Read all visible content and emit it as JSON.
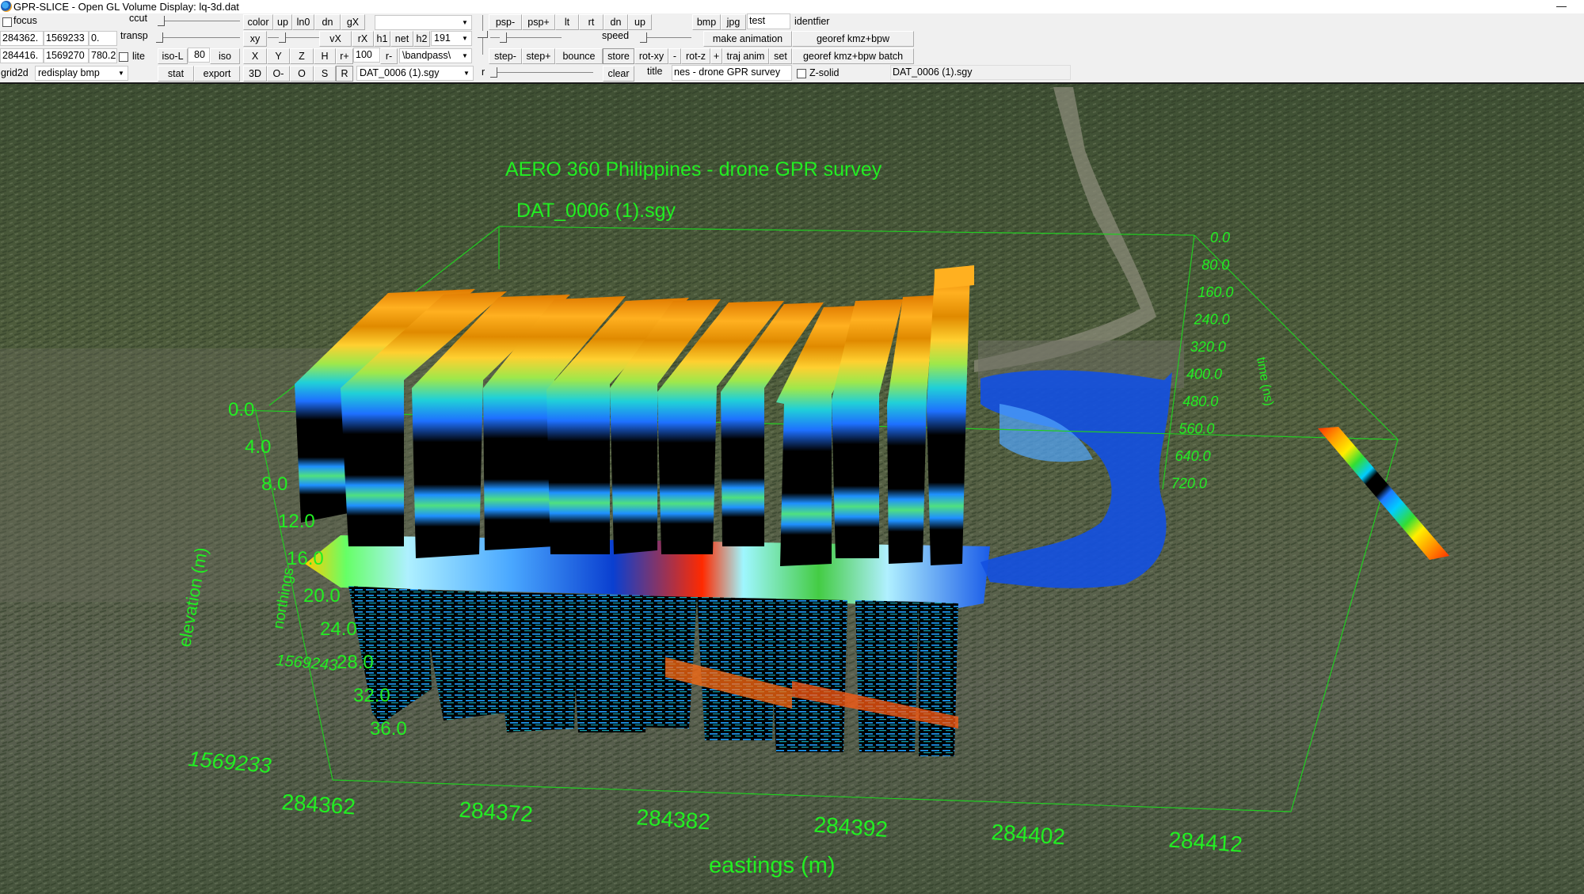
{
  "window": {
    "title": "GPR-SLICE -  Open GL Volume Display:     lq-3d.dat",
    "minimize_icon": "minimize-icon"
  },
  "toolbar": {
    "focus_label": "focus",
    "focus_checked": false,
    "ccut_label": "ccut",
    "transp_label": "transp",
    "coord_min_x": "284362.",
    "coord_min_y": "1569233",
    "coord_min_z": "0.",
    "coord_max_x": "284416.",
    "coord_max_y": "1569270",
    "coord_max_z": "780.2",
    "lite_label": "lite",
    "lite_checked": false,
    "iso_l_label": "iso-L",
    "iso_value": "80",
    "iso_label": "iso",
    "grid2d_label": "grid2d",
    "redisplay_select": "redisplay bmp",
    "stat_label": "stat",
    "export_label": "export",
    "color_label": "color",
    "up_label": "up",
    "ln0_label": "ln0",
    "dn_label": "dn",
    "gx_label": "gX",
    "top_combo_value": "",
    "xy_label": "xy",
    "vx_label": "vX",
    "rx_label": "rX",
    "h1_label": "h1",
    "net_label": "net",
    "h2_label": "h2",
    "h2_value": "191",
    "x_label": "X",
    "y_label": "Y",
    "z_label": "Z",
    "h_label": "H",
    "rplus_label": "r+",
    "r_value": "100",
    "rminus_label": "r-",
    "filter_select": "\\bandpass\\",
    "btn_3d": "3D",
    "btn_ominus": "O-",
    "btn_o": "O",
    "btn_s": "S",
    "btn_r": "R",
    "file_select": "DAT_0006 (1).sgy",
    "r_slider_label": "r",
    "psp_minus": "psp-",
    "psp_plus": "psp+",
    "lt_label": "lt",
    "rt_label": "rt",
    "dn2_label": "dn",
    "up2_label": "up",
    "speed_label": "speed",
    "step_minus": "step-",
    "step_plus": "step+",
    "bounce_label": "bounce",
    "store_label": "store",
    "rot_xy_label": "rot-xy",
    "minus_label": "-",
    "rot_z_label": "rot-z",
    "plus_label": "+",
    "traj_anim_label": "traj anim",
    "set_label": "set",
    "clear_label": "clear",
    "title_label": "title",
    "title_value": "nes - drone GPR survey",
    "bmp_label": "bmp",
    "jpg_label": "jpg",
    "identifier_value": "test",
    "identifier_label": "identfier",
    "make_animation_label": "make animation",
    "georef_label": "georef kmz+bpw",
    "georef_batch_label": "georef kmz+bpw batch",
    "zsolid_label": "Z-solid",
    "zsolid_checked": false,
    "current_file_display": "DAT_0006 (1).sgy"
  },
  "scene": {
    "title": "AERO 360 Philippines - drone GPR survey",
    "subtitle": "DAT_0006 (1).sgy",
    "axis_color": "#22ee22",
    "elevation_axis": {
      "label": "elevation (m)",
      "ticks": [
        "0.0",
        "4.0",
        "8.0",
        "12.0",
        "16.0",
        "20.0",
        "24.0",
        "28.0",
        "32.0",
        "36.0"
      ]
    },
    "time_axis": {
      "label": "time (ns)",
      "ticks": [
        "0.0",
        "80.0",
        "160.0",
        "240.0",
        "320.0",
        "400.0",
        "480.0",
        "560.0",
        "640.0",
        "720.0"
      ]
    },
    "northings_axis": {
      "label": "northings",
      "ticks": [
        "1569233",
        "1569243"
      ]
    },
    "eastings_axis": {
      "label": "eastings (m)",
      "ticks": [
        "284362",
        "284372",
        "284382",
        "284392",
        "284402",
        "284412"
      ]
    },
    "colorbar": [
      "#ff2a00",
      "#ff9900",
      "#ffee00",
      "#33dd33",
      "#00ccff",
      "#000000",
      "#1e78ff",
      "#00ccff",
      "#33dd33",
      "#ffee00",
      "#ff9900",
      "#ff2a00"
    ]
  }
}
